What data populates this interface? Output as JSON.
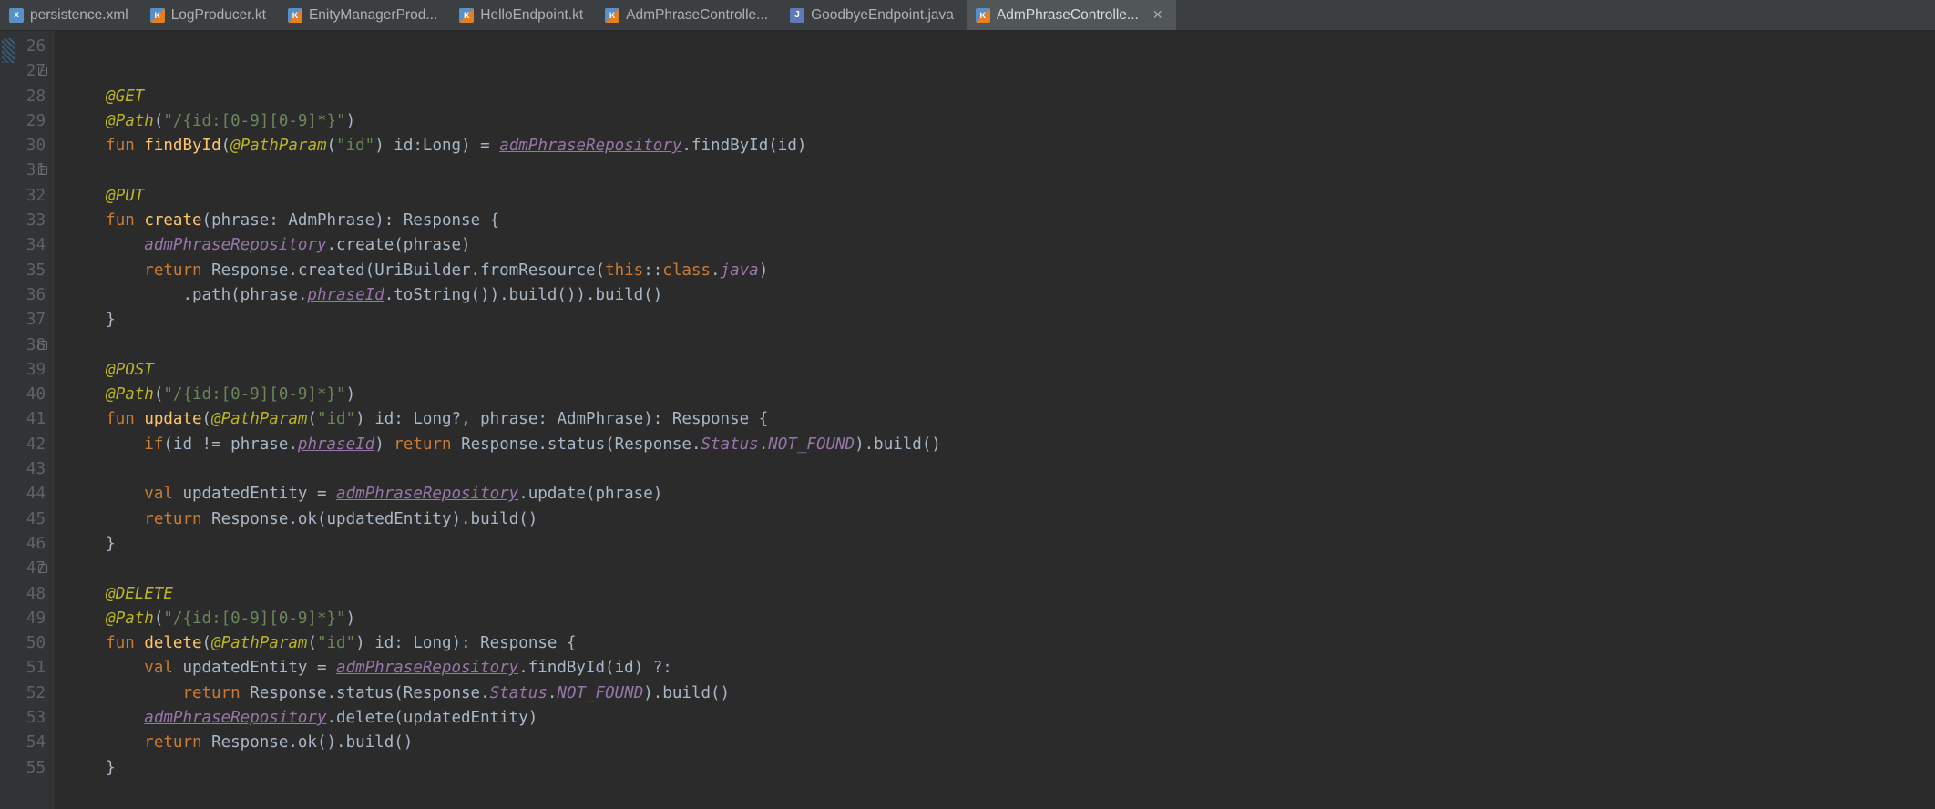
{
  "tabs": [
    {
      "label": "persistence.xml",
      "icon": "xml",
      "active": false
    },
    {
      "label": "LogProducer.kt",
      "icon": "kt",
      "active": false
    },
    {
      "label": "EnityManagerProd...",
      "icon": "kt",
      "active": false
    },
    {
      "label": "HelloEndpoint.kt",
      "icon": "kt",
      "active": false
    },
    {
      "label": "AdmPhraseControlle...",
      "icon": "kt",
      "active": false
    },
    {
      "label": "GoodbyeEndpoint.java",
      "icon": "java",
      "active": false
    },
    {
      "label": "AdmPhraseControlle...",
      "icon": "kt",
      "active": true,
      "closeable": true
    }
  ],
  "gutter": {
    "start": 26,
    "end": 55,
    "foldable": [
      27,
      31,
      38,
      47
    ]
  },
  "code": {
    "l27": {
      "ann": "@GET"
    },
    "l28": {
      "ann": "@Path",
      "arg": "\"/{id:[0-9][0-9]*}\""
    },
    "l29": {
      "kw_fun": "fun",
      "fn": "findById",
      "pp": "@PathParam",
      "pp_arg": "\"id\"",
      "p": "id",
      "t": "Long",
      "eq": " = ",
      "repo": "admPhraseRepository",
      "m": ".findById(",
      "a": "id",
      "end": ")"
    },
    "l31": {
      "ann": "@PUT"
    },
    "l32": {
      "kw_fun": "fun",
      "fn": "create",
      "p": "phrase",
      "t": "AdmPhrase",
      "ret": "Response",
      "brace": " {"
    },
    "l33": {
      "repo": "admPhraseRepository",
      "m": ".create(",
      "a": "phrase",
      "end": ")"
    },
    "l34": {
      "kw": "return ",
      "cls": "Response",
      "m1": ".created(",
      "cls2": "UriBuilder",
      "m2": ".fromResource(",
      "kw2": "this",
      "op": "::",
      "kw3": "class",
      "dot": ".",
      "it": "java",
      "end": ")"
    },
    "l35": {
      "m": ".path(",
      "a": "phrase",
      "dot": ".",
      "prop": "phraseId",
      "m2": ".toString()).build()).build()"
    },
    "l36": {
      "brace": "}"
    },
    "l38": {
      "ann": "@POST"
    },
    "l39": {
      "ann": "@Path",
      "arg": "\"/{id:[0-9][0-9]*}\""
    },
    "l40": {
      "kw_fun": "fun",
      "fn": "update",
      "pp": "@PathParam",
      "pp_arg": "\"id\"",
      "p1": "id",
      "t1": "Long?",
      "p2": "phrase",
      "t2": "AdmPhrase",
      "ret": "Response",
      "brace": " {"
    },
    "l41": {
      "kw": "if",
      "open": "(",
      "a": "id",
      " op": " != ",
      "b": "phrase",
      "dot": ".",
      "prop": "phraseId",
      "close": ") ",
      "kw2": "return ",
      "cls": "Response",
      "m": ".status(",
      "cls2": "Response",
      "dot2": ".",
      "it": "Status",
      "dot3": ".",
      "c": "NOT_FOUND",
      "end": ").build()"
    },
    "l43": {
      "kw": "val ",
      "v": "updatedEntity",
      " eq": " = ",
      "repo": "admPhraseRepository",
      "m": ".update(",
      "a": "phrase",
      "end": ")"
    },
    "l44": {
      "kw": "return ",
      "cls": "Response",
      "m": ".ok(",
      "a": "updatedEntity",
      "end": ").build()"
    },
    "l45": {
      "brace": "}"
    },
    "l47": {
      "ann": "@DELETE"
    },
    "l48": {
      "ann": "@Path",
      "arg": "\"/{id:[0-9][0-9]*}\""
    },
    "l49": {
      "kw_fun": "fun",
      "fn": "delete",
      "pp": "@PathParam",
      "pp_arg": "\"id\"",
      "p": "id",
      "t": "Long",
      "ret": "Response",
      "brace": " {"
    },
    "l50": {
      "kw": "val ",
      "v": "updatedEntity",
      " eq": " = ",
      "repo": "admPhraseRepository",
      "m": ".findById(",
      "a": "id",
      "end": ") ?:"
    },
    "l51": {
      "kw": "return ",
      "cls": "Response",
      "m": ".status(",
      "cls2": "Response",
      "dot": ".",
      "it": "Status",
      "dot2": ".",
      "c": "NOT_FOUND",
      "end": ").build()"
    },
    "l52": {
      "repo": "admPhraseRepository",
      "m": ".delete(",
      "a": "updatedEntity",
      "end": ")"
    },
    "l53": {
      "kw": "return ",
      "cls": "Response",
      "m": ".ok().build()"
    },
    "l54": {
      "brace": "}"
    }
  }
}
